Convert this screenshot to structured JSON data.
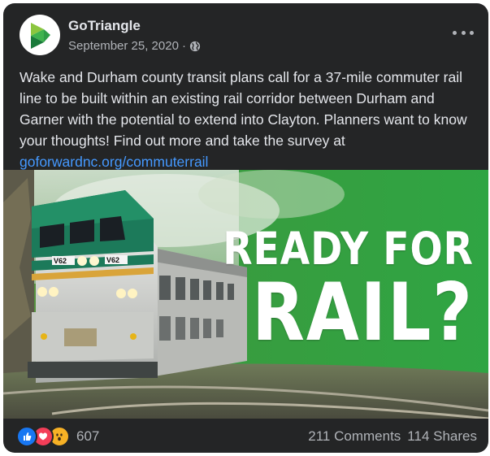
{
  "post": {
    "page_name": "GoTriangle",
    "date": "September 25, 2020",
    "separator": "·",
    "body": "Wake and Durham county transit plans call for a 37-mile commuter rail line to be built within an existing rail corridor between Durham and Garner with the potential to extend into Clayton. Planners want to know your thoughts! Find out more and take the survey at",
    "link": "goforwardnc.org/commuterrail"
  },
  "image": {
    "headline_line1": "READY FOR",
    "headline_line2": "RAIL?",
    "locomotive_number_left": "V62",
    "locomotive_number_right": "V62"
  },
  "footer": {
    "reaction_count": "607",
    "comments": "211 Comments",
    "shares": "114 Shares"
  },
  "colors": {
    "card_bg": "#242526",
    "text": "#e4e6eb",
    "muted": "#b0b3b8",
    "link": "#4599ff",
    "brand_green": "#3fb34f"
  },
  "icons": [
    "gotriangle-logo-icon",
    "globe-icon",
    "more-options-icon",
    "like-reaction-icon",
    "love-reaction-icon",
    "wow-reaction-icon"
  ]
}
